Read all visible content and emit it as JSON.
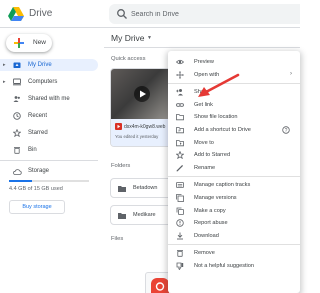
{
  "header": {
    "app_title": "Drive",
    "search_placeholder": "Search in Drive"
  },
  "sidebar": {
    "new_label": "New",
    "items": [
      {
        "label": "My Drive",
        "icon": "drive-folder-icon",
        "active": true,
        "expandable": true
      },
      {
        "label": "Computers",
        "icon": "computer-icon",
        "active": false,
        "expandable": true
      },
      {
        "label": "Shared with me",
        "icon": "people-icon",
        "active": false,
        "expandable": false
      },
      {
        "label": "Recent",
        "icon": "clock-icon",
        "active": false,
        "expandable": false
      },
      {
        "label": "Starred",
        "icon": "star-icon",
        "active": false,
        "expandable": false
      },
      {
        "label": "Bin",
        "icon": "trash-icon",
        "active": false,
        "expandable": false
      }
    ],
    "storage": {
      "label": "Storage",
      "usage_text": "4.4 GB of 15 GB used",
      "used_fraction": 0.29,
      "buy_label": "Buy storage"
    }
  },
  "main": {
    "breadcrumb": "My Drive",
    "quick_access_label": "Quick access",
    "quick_access_item": {
      "name": "dsx4m-k0gw8.web",
      "meta": "You edited it yesterday"
    },
    "folders_label": "Folders",
    "folders": [
      "Betadown",
      "Medikare"
    ],
    "files_label": "Files"
  },
  "context_menu": {
    "items": [
      {
        "label": "Preview",
        "icon": "eye-icon"
      },
      {
        "label": "Open with",
        "icon": "open-with-icon",
        "submenu": true
      },
      {
        "separator": true
      },
      {
        "label": "Share",
        "icon": "person-add-icon"
      },
      {
        "label": "Get link",
        "icon": "link-icon"
      },
      {
        "label": "Show file location",
        "icon": "folder-icon"
      },
      {
        "label": "Add a shortcut to Drive",
        "icon": "shortcut-icon",
        "help": true
      },
      {
        "label": "Move to",
        "icon": "move-icon"
      },
      {
        "label": "Add to Starred",
        "icon": "star-icon"
      },
      {
        "label": "Rename",
        "icon": "pencil-icon"
      },
      {
        "separator": true
      },
      {
        "label": "Manage caption tracks",
        "icon": "captions-icon"
      },
      {
        "label": "Manage versions",
        "icon": "versions-icon"
      },
      {
        "label": "Make a copy",
        "icon": "copy-icon"
      },
      {
        "label": "Report abuse",
        "icon": "report-icon"
      },
      {
        "label": "Download",
        "icon": "download-icon"
      },
      {
        "separator": true
      },
      {
        "label": "Remove",
        "icon": "trash-icon"
      },
      {
        "label": "Not a helpful suggestion",
        "icon": "thumb-down-icon"
      }
    ]
  },
  "colors": {
    "accent": "#1a73e8",
    "active_bg": "#e8f0fe",
    "annotation": "#e53935"
  }
}
